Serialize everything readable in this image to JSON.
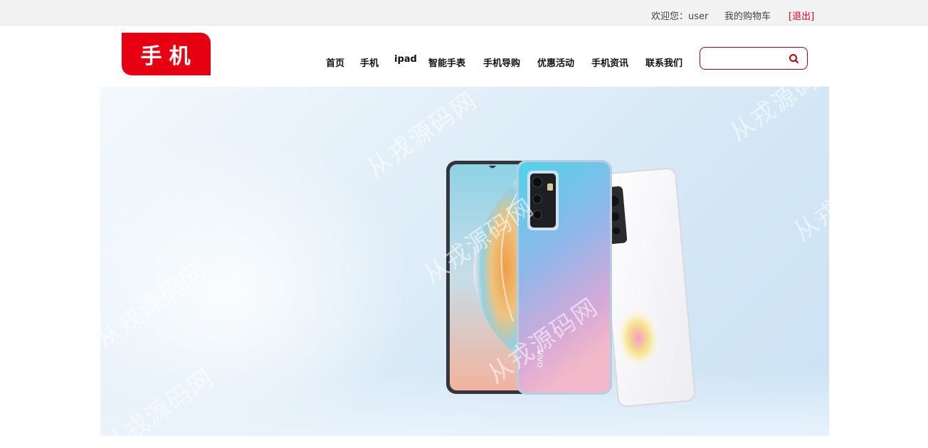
{
  "topbar": {
    "welcome_label": "欢迎您：",
    "username": "user",
    "cart_link": "我的购物车",
    "logout_link": "[退出]"
  },
  "logo": {
    "text": "手机"
  },
  "nav": {
    "items": [
      {
        "label": "首页"
      },
      {
        "label": "手机"
      },
      {
        "label": "ipad"
      },
      {
        "label": "智能手表"
      },
      {
        "label": "手机导购"
      },
      {
        "label": "优惠活动"
      },
      {
        "label": "手机资讯"
      },
      {
        "label": "联系我们"
      }
    ]
  },
  "search": {
    "value": "",
    "placeholder": ""
  },
  "banner": {
    "phone_brand": "vivo",
    "watermark": "从戎源码网"
  },
  "colors": {
    "accent": "#e60012",
    "topbar_bg": "#f2f2f2",
    "nav_text": "#111111"
  }
}
